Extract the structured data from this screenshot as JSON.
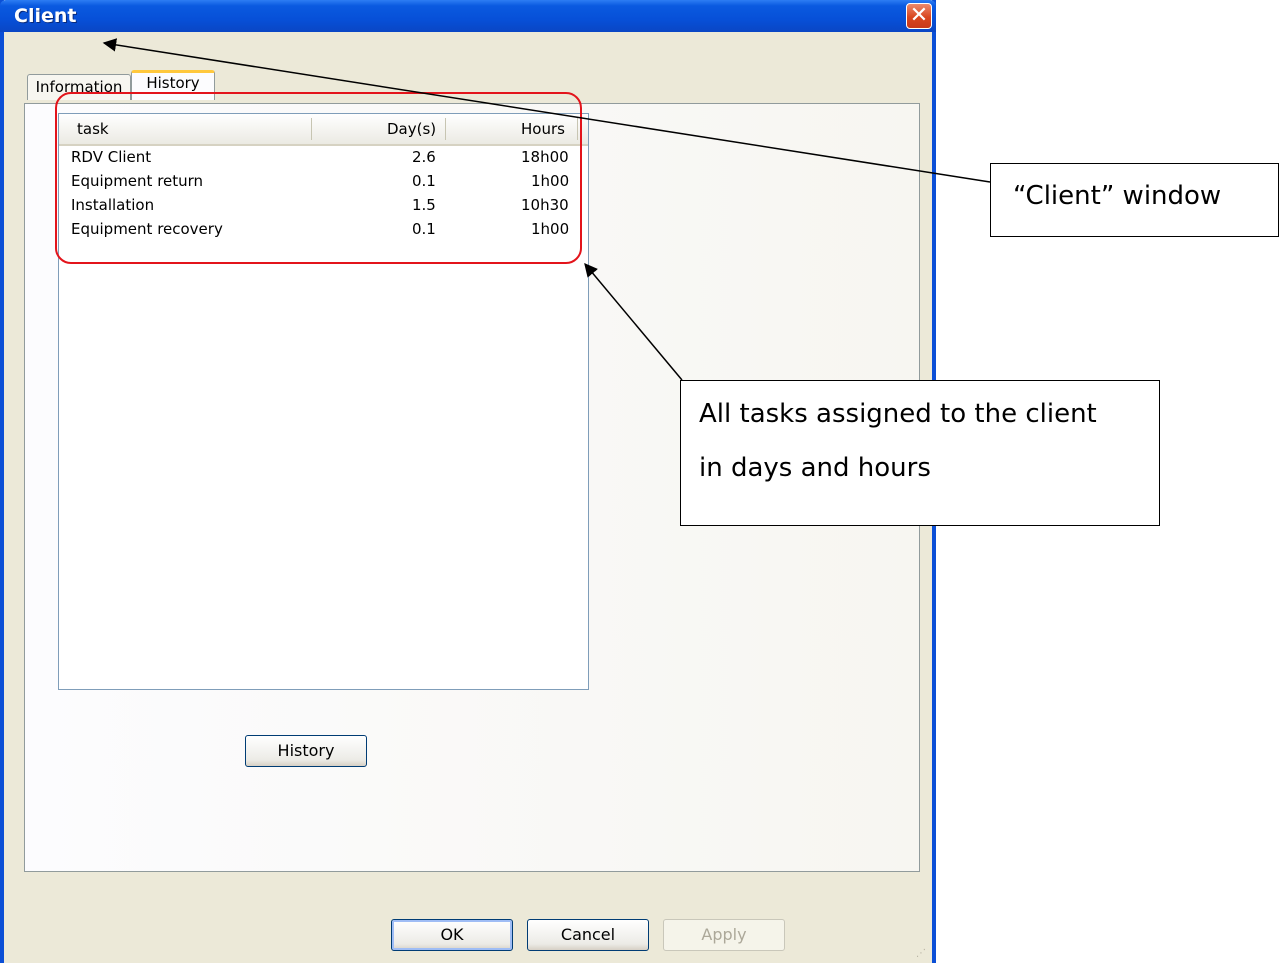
{
  "window": {
    "title": "Client"
  },
  "tabs": [
    {
      "label": "Information",
      "active": false
    },
    {
      "label": "History",
      "active": true
    }
  ],
  "listview": {
    "columns": [
      "task",
      "Day(s)",
      "Hours"
    ],
    "rows": [
      {
        "task": "RDV Client",
        "days": "2.6",
        "hours": "18h00"
      },
      {
        "task": "Equipment return",
        "days": "0.1",
        "hours": "1h00"
      },
      {
        "task": "Installation",
        "days": "1.5",
        "hours": "10h30"
      },
      {
        "task": "Equipment recovery",
        "days": "0.1",
        "hours": "1h00"
      }
    ]
  },
  "buttons": {
    "history": "History",
    "ok": "OK",
    "cancel": "Cancel",
    "apply": "Apply"
  },
  "annotations": {
    "window_callout": "“Client” window",
    "tasks_callout_line1": "All tasks assigned to the client",
    "tasks_callout_line2": "in days and hours"
  },
  "colors": {
    "titlebar": "#0a5ae0",
    "highlight": "#e3141b",
    "window_bg": "#ece9d8"
  }
}
